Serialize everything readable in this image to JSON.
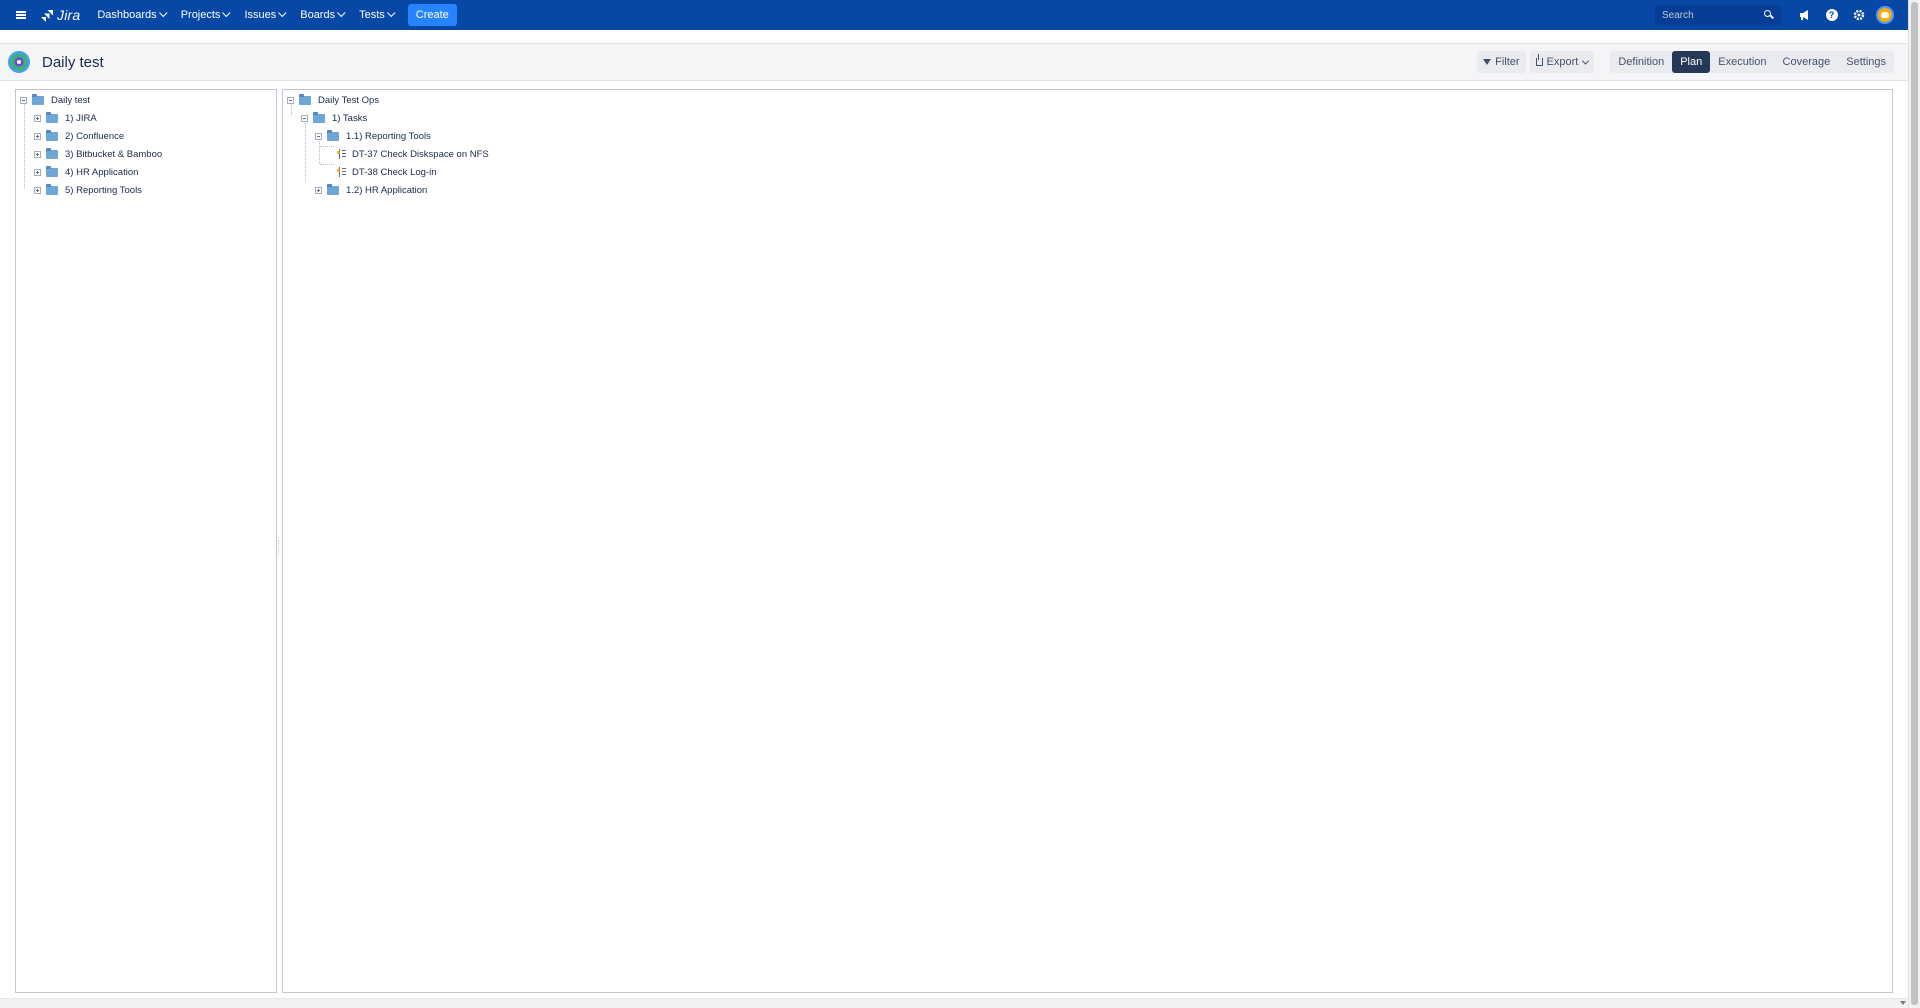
{
  "topnav": {
    "logo_text": "Jira",
    "menu": [
      {
        "label": "Dashboards"
      },
      {
        "label": "Projects"
      },
      {
        "label": "Issues"
      },
      {
        "label": "Boards"
      },
      {
        "label": "Tests"
      }
    ],
    "create_label": "Create",
    "search_placeholder": "Search",
    "icons": [
      "menu-icon",
      "jira-logo-icon",
      "notifications-icon",
      "help-icon",
      "settings-icon",
      "user-avatar"
    ]
  },
  "header": {
    "title": "Daily test",
    "filter_label": "Filter",
    "export_label": "Export",
    "tabs": [
      {
        "label": "Definition",
        "active": false
      },
      {
        "label": "Plan",
        "active": true
      },
      {
        "label": "Execution",
        "active": false
      },
      {
        "label": "Coverage",
        "active": false
      },
      {
        "label": "Settings",
        "active": false
      }
    ]
  },
  "left_tree": {
    "root": "Daily test",
    "children": [
      "1) JIRA",
      "2) Confluence",
      "3) Bitbucket & Bamboo",
      "4) HR Application",
      "5) Reporting Tools"
    ]
  },
  "right_tree": {
    "root": "Daily Test Ops",
    "tasks": "1) Tasks",
    "reporting": "1.1) Reporting Tools",
    "tests": [
      "DT-37 Check Diskspace on NFS",
      "DT-38 Check Log-in"
    ],
    "hr": "1.2) HR Application"
  },
  "colors": {
    "nav_bg": "#0747a6",
    "create_bg": "#2684ff",
    "active_tab": "#253858"
  }
}
